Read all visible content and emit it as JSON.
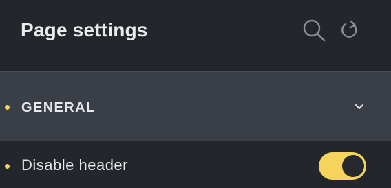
{
  "header": {
    "title": "Page settings",
    "search_icon": "search-icon",
    "refresh_icon": "refresh-icon"
  },
  "section": {
    "label": "GENERAL",
    "expanded": false,
    "chevron_icon": "chevron-down-icon"
  },
  "settings": [
    {
      "label": "Disable header",
      "enabled": true
    }
  ],
  "colors": {
    "background": "#23262b",
    "section_background": "#3a3e46",
    "accent": "#f5d35d",
    "text": "#e6e8ec",
    "icon": "#8a8e96",
    "divider": "#4a4e55"
  }
}
